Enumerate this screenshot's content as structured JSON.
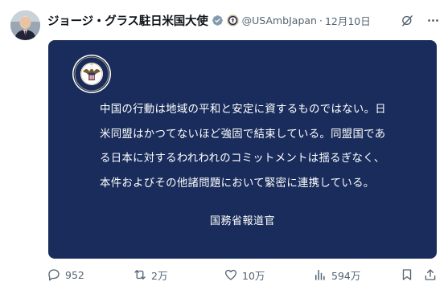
{
  "tweet": {
    "author_name": "ジョージ・グラス駐日米国大使",
    "handle": "@USAmbJapan",
    "separator": "·",
    "date": "12月10日",
    "card": {
      "lines": [
        "中国の行動は地域の平和と安定に資するものではない。日",
        "米同盟はかつてないほど強固で結束している。同盟国であ",
        "る日本に対するわれわれのコミットメントは揺るぎなく、",
        "本件およびその他諸問題において緊密に連携している。"
      ],
      "signature": "国務省報道官",
      "background_color": "#192c5b"
    },
    "actions": {
      "replies": "952",
      "reposts": "2万",
      "likes": "10万",
      "views": "594万"
    },
    "icons": [
      "verified-badge-icon",
      "state-department-seal-icon",
      "grok-icon",
      "more-icon",
      "reply-icon",
      "repost-icon",
      "like-icon",
      "views-icon",
      "bookmark-icon",
      "share-icon"
    ],
    "colors": {
      "verified": "#829aab",
      "muted": "#536471",
      "text": "#0f1419"
    }
  }
}
